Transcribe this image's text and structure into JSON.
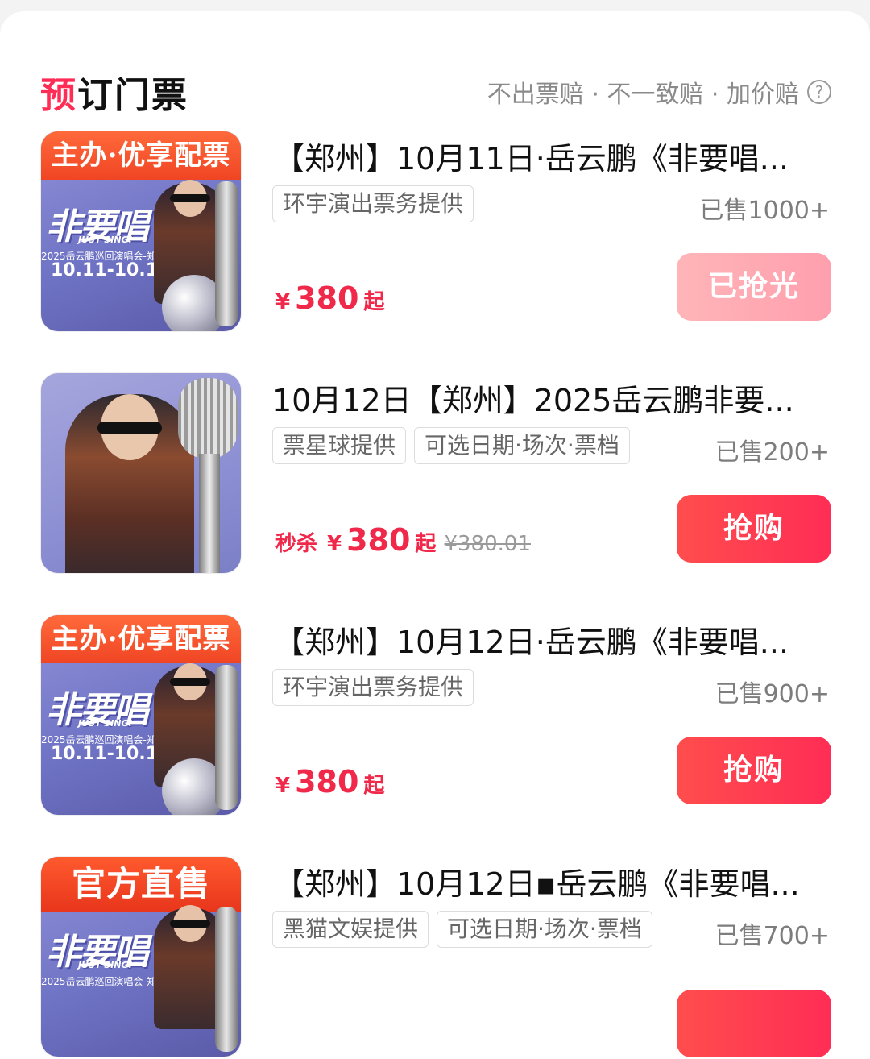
{
  "header": {
    "title": "预订门票",
    "guarantee": "不出票赔 · 不一致赔 · 加价赔",
    "help_icon": "?"
  },
  "items": [
    {
      "title": "【郑州】10月11日·岳云鹏《非要唱...",
      "tags": [
        "环宇演出票务提供"
      ],
      "sold": "已售1000+",
      "price_currency": "¥",
      "price_amount": "380",
      "price_suffix": "起",
      "button": "已抢光",
      "button_state": "disabled",
      "thumb": {
        "banner": "主办·优享配票",
        "poster_title": "非要唱",
        "poster_sub": "JUST SING!",
        "poster_line": "2025岳云鹏巡回演唱会-郑州站",
        "poster_dates": "10.11-10.12"
      }
    },
    {
      "title": "10月12日【郑州】2025岳云鹏非要...",
      "tags": [
        "票星球提供",
        "可选日期·场次·票档"
      ],
      "sold": "已售200+",
      "price_flash": "秒杀",
      "price_currency": "¥",
      "price_amount": "380",
      "price_suffix": "起",
      "price_original": "¥380.01",
      "button": "抢购",
      "button_state": "active"
    },
    {
      "title": "【郑州】10月12日·岳云鹏《非要唱...",
      "tags": [
        "环宇演出票务提供"
      ],
      "sold": "已售900+",
      "price_currency": "¥",
      "price_amount": "380",
      "price_suffix": "起",
      "button": "抢购",
      "button_state": "active",
      "thumb": {
        "banner": "主办·优享配票",
        "poster_title": "非要唱",
        "poster_sub": "JUST SING!",
        "poster_line": "2025岳云鹏巡回演唱会-郑州站",
        "poster_dates": "10.11-10.12"
      }
    },
    {
      "title": "【郑州】10月12日▪岳云鹏《非要唱...",
      "tags": [
        "黑猫文娱提供",
        "可选日期·场次·票档"
      ],
      "sold": "已售700+",
      "thumb": {
        "banner": "官方直售",
        "poster_title": "非要唱",
        "poster_sub": "JUST SING!",
        "poster_line": "2025岳云鹏巡回演唱会-郑州站"
      }
    }
  ],
  "colors": {
    "accent": "#ff2d55",
    "price": "#f0284a",
    "button_disabled": "#ffaab3"
  }
}
